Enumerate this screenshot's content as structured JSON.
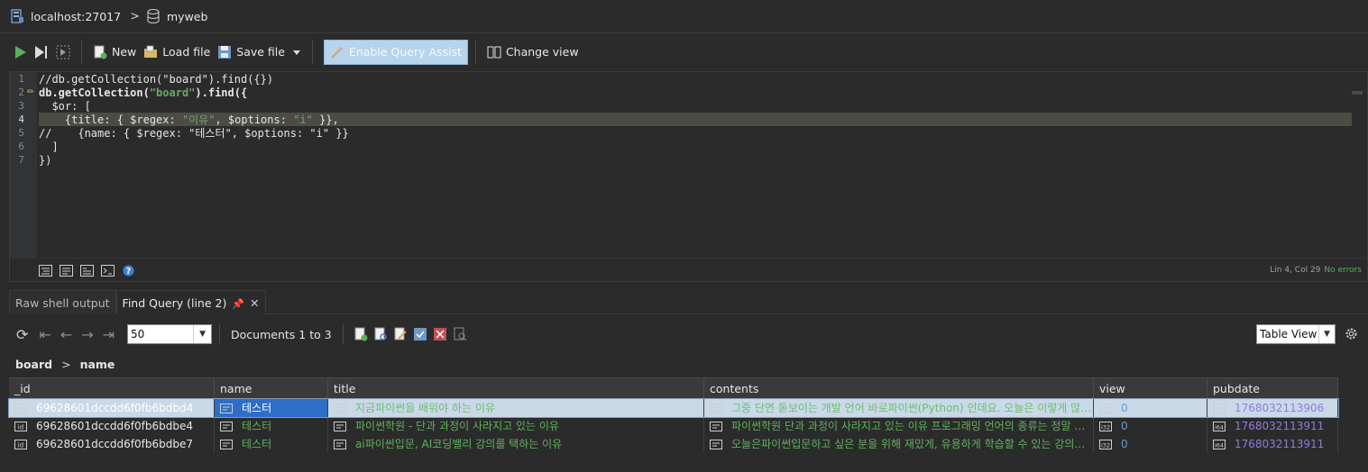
{
  "connection": {
    "host": "localhost:27017",
    "database": "myweb"
  },
  "toolbar": {
    "new_label": "New",
    "load_label": "Load file",
    "save_label": "Save file",
    "assist_label": "Enable Query Assist",
    "change_view_label": "Change view"
  },
  "editor": {
    "line_numbers": [
      "1",
      "2",
      "3",
      "4",
      "5",
      "6",
      "7"
    ],
    "lines": [
      "//db.getCollection(\"board\").find({})",
      "db.getCollection(\"board\").find({",
      "  $or: [",
      "    {title: { $regex: \"이유\", $options: \"i\" }},",
      "//    {name: { $regex: \"테스터\", $options: \"i\" }}",
      "  ]",
      "})"
    ],
    "status_pos": "Lin 4, Col 29",
    "status_errors": "No errors"
  },
  "result_tabs": [
    {
      "label": "Raw shell output"
    },
    {
      "label": "Find Query (line 2)"
    }
  ],
  "result_toolbar": {
    "page_size": "50",
    "documents_label": "Documents 1 to 3",
    "view_mode": "Table View"
  },
  "breadcrumb": {
    "collection": "board",
    "field": "name"
  },
  "table": {
    "columns": [
      "_id",
      "name",
      "title",
      "contents",
      "view",
      "pubdate"
    ],
    "rows": [
      {
        "_id": "69628601dccdd6f0fb6bdbd4",
        "name": "테스터",
        "title": "지금파이썬을 배워야 하는 이유",
        "contents": "그중 단연 돋보이는 개발 언어 바로파이썬(Python) 인데요. 오늘은 이렇게 많은 사람들이 파이썬을 배우고 있는 이유",
        "view": "0",
        "pubdate": "1768032113906"
      },
      {
        "_id": "69628601dccdd6f0fb6bdbe4",
        "name": "테스터",
        "title": "파이썬학원 - 단과 과정이 사라지고 있는 이유",
        "contents": "파이썬학원 단과 과정이 사라지고 있는 이유 프로그래밍 언어의 종류는 정말 다양합니다",
        "view": "0",
        "pubdate": "1768032113911"
      },
      {
        "_id": "69628601dccdd6f0fb6bdbe7",
        "name": "테스터",
        "title": "ai파이썬입문, AI코딩밸리 강의를 택하는 이유",
        "contents": "오늘은파이썬입문하고 싶은 분을 위해 재밌게, 유용하게 학습할 수 있는 강의를 소개합니다",
        "view": "0",
        "pubdate": "1768032113911"
      }
    ]
  }
}
